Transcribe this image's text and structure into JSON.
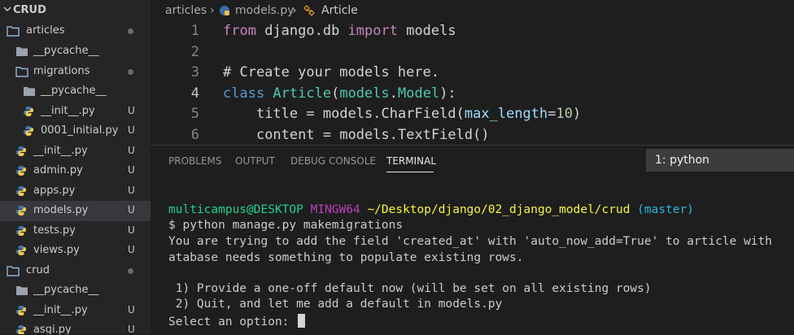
{
  "explorer": {
    "root": "CRUD",
    "items": [
      {
        "label": "articles",
        "kind": "folder",
        "marker": "dot"
      },
      {
        "label": "__pycache__",
        "kind": "folder-closed",
        "marker": ""
      },
      {
        "label": "migrations",
        "kind": "folder",
        "marker": "dot"
      },
      {
        "label": "__pycache__",
        "kind": "folder-closed",
        "marker": ""
      },
      {
        "label": "__init__.py",
        "kind": "python",
        "marker": "U"
      },
      {
        "label": "0001_initial.py",
        "kind": "python",
        "marker": "U"
      },
      {
        "label": "__init__.py",
        "kind": "python",
        "marker": "U"
      },
      {
        "label": "admin.py",
        "kind": "python",
        "marker": "U"
      },
      {
        "label": "apps.py",
        "kind": "python",
        "marker": "U"
      },
      {
        "label": "models.py",
        "kind": "python",
        "marker": "U"
      },
      {
        "label": "tests.py",
        "kind": "python",
        "marker": "U"
      },
      {
        "label": "views.py",
        "kind": "python",
        "marker": "U"
      },
      {
        "label": "crud",
        "kind": "folder",
        "marker": "dot"
      },
      {
        "label": "__pycache__",
        "kind": "folder-closed",
        "marker": ""
      },
      {
        "label": "__init__.py",
        "kind": "python",
        "marker": "U"
      },
      {
        "label": "asgi.py",
        "kind": "python",
        "marker": "U"
      }
    ]
  },
  "breadcrumb": {
    "folder": "articles",
    "file": "models.py",
    "symbol": "Article"
  },
  "editor": {
    "line_numbers": [
      "1",
      "2",
      "3",
      "4",
      "5",
      "6"
    ],
    "lines": {
      "l1": {
        "kw1": "from",
        "mod": " django.db ",
        "kw2": "import",
        "rest": " models"
      },
      "l3": {
        "comment": "# Create your models here."
      },
      "l4": {
        "kw": "class",
        "name": " Article",
        "p1": "(",
        "base1": "models",
        "dot": ".",
        "base2": "Model",
        "p2": "):"
      },
      "l5": {
        "indent": "    ",
        "var": "title",
        "eq": " = ",
        "obj": "models",
        "dot": ".",
        "fn": "CharField",
        "p1": "(",
        "arg": "max_length",
        "eq2": "=",
        "num": "10",
        "p2": ")"
      },
      "l6": {
        "indent": "    ",
        "var": "content",
        "eq": " = ",
        "obj": "models",
        "dot": ".",
        "fn": "TextField",
        "p": "()"
      }
    }
  },
  "panel": {
    "tabs": [
      "PROBLEMS",
      "OUTPUT",
      "DEBUG CONSOLE",
      "TERMINAL"
    ],
    "active_tab": "TERMINAL",
    "terminal_select": "1: python",
    "terminal": {
      "prompt_user": "multicampus@DESKTOP",
      "prompt_env": "MINGW64",
      "prompt_path": "~/Desktop/django/02_django_model/crud",
      "prompt_branch": "(master)",
      "command": "$ python manage.py makemigrations",
      "out1": "You are trying to add the field 'created_at' with 'auto_now_add=True' to article with",
      "out2": "atabase needs something to populate existing rows.",
      "opt1": " 1) Provide a one-off default now (will be set on all existing rows)",
      "opt2": " 2) Quit, and let me add a default in models.py",
      "select_prompt": "Select an option: "
    }
  },
  "colors": {
    "sidebar_bg": "#252526",
    "editor_bg": "#1e1e1e",
    "keyword": "#c586c0",
    "class": "#4ec9b0",
    "comment": "#6a9955",
    "terminal_green": "#23d18b",
    "terminal_purple": "#bc3fbc",
    "terminal_yellow": "#f5f543",
    "terminal_cyan": "#29b8db"
  }
}
